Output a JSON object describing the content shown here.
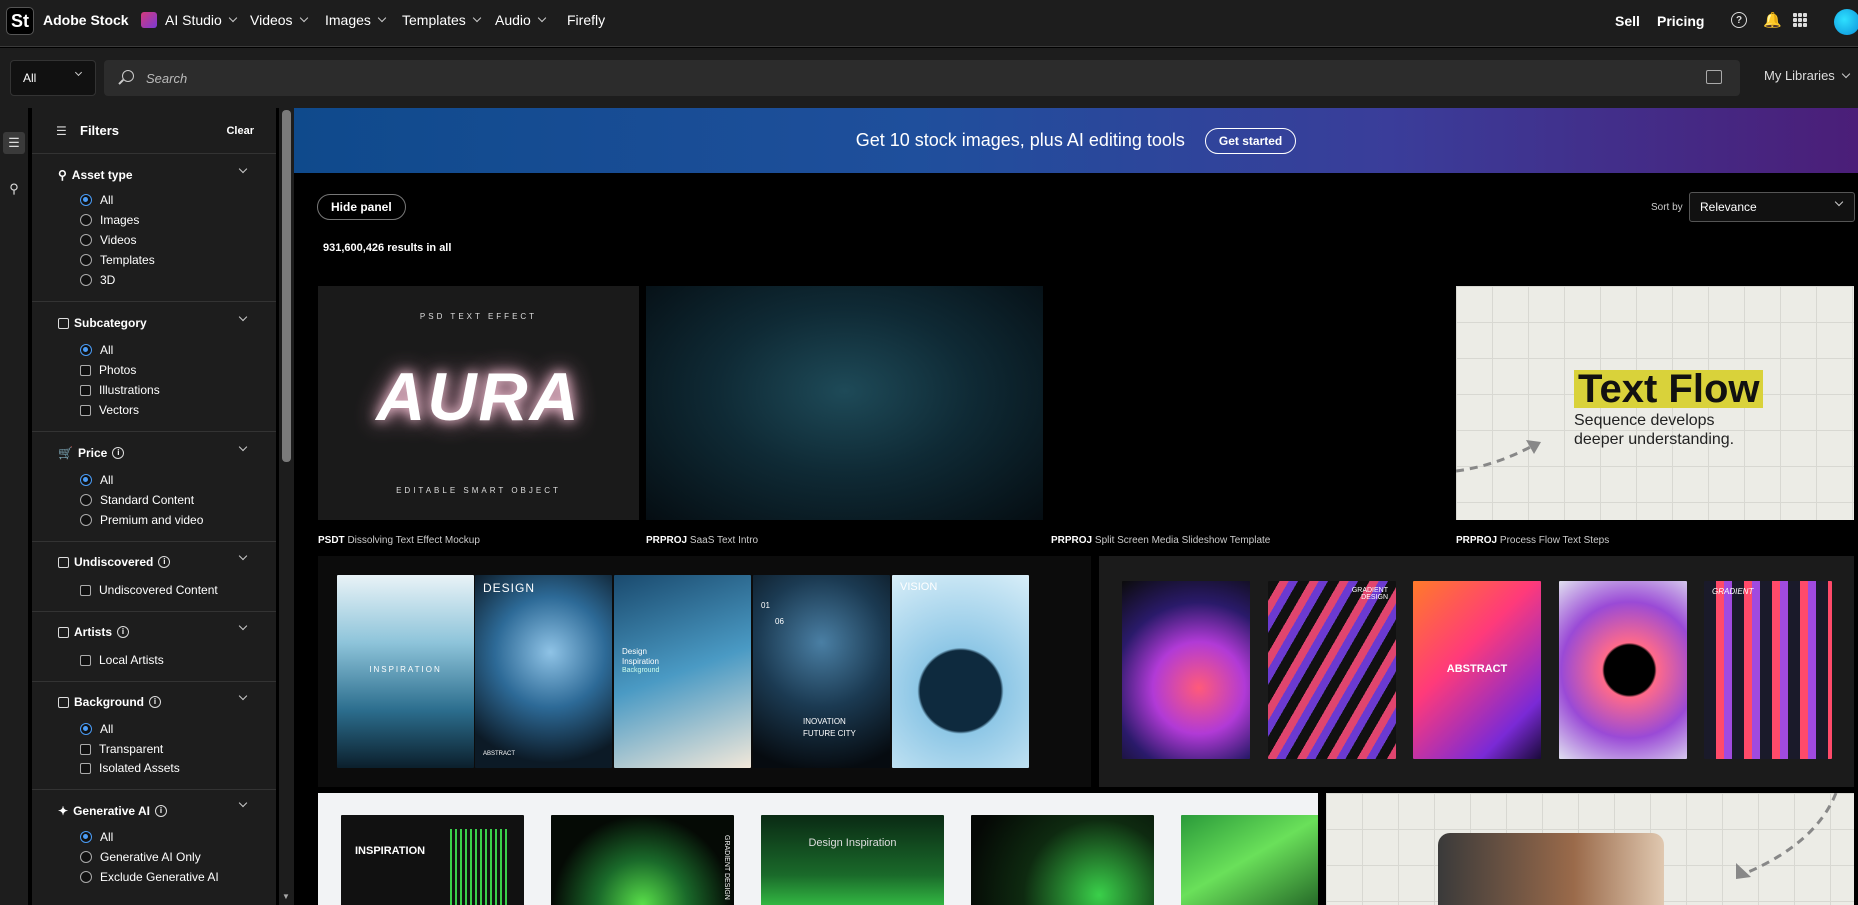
{
  "topnav": {
    "logo": "St",
    "brand": "Adobe Stock",
    "items": [
      "AI Studio",
      "Videos",
      "Images",
      "Templates",
      "Audio",
      "Firefly"
    ],
    "right": [
      "Sell",
      "Pricing"
    ],
    "help": "?"
  },
  "search": {
    "scope": "All",
    "placeholder": "Search",
    "my_libraries": "My Libraries"
  },
  "filters": {
    "title": "Filters",
    "clear": "Clear",
    "asset_type": {
      "title": "Asset type",
      "options": [
        "All",
        "Images",
        "Videos",
        "Templates",
        "3D"
      ],
      "selected": "All"
    },
    "subcategory": {
      "title": "Subcategory",
      "options": [
        "All",
        "Photos",
        "Illustrations",
        "Vectors"
      ],
      "selected": "All"
    },
    "price": {
      "title": "Price",
      "options": [
        "All",
        "Standard Content",
        "Premium and video"
      ],
      "selected": "All"
    },
    "undiscovered": {
      "title": "Undiscovered",
      "options": [
        "Undiscovered Content"
      ]
    },
    "artists": {
      "title": "Artists",
      "options": [
        "Local Artists"
      ]
    },
    "background": {
      "title": "Background",
      "options": [
        "All",
        "Transparent",
        "Isolated Assets"
      ],
      "selected": "All"
    },
    "generative_ai": {
      "title": "Generative AI",
      "options": [
        "All",
        "Generative AI Only",
        "Exclude Generative AI"
      ],
      "selected": "All"
    }
  },
  "promo": {
    "text": "Get 10 stock images, plus AI editing tools",
    "cta": "Get started"
  },
  "main": {
    "hide_panel": "Hide panel",
    "results": "931,600,426 results in all",
    "sort_label": "Sort by",
    "sort_value": "Relevance"
  },
  "tiles": [
    {
      "type": "PSDT",
      "title": "Dissolving Text Effect Mockup",
      "top": "PSD TEXT EFFECT",
      "word": "AURA",
      "bottom": "EDITABLE SMART OBJECT"
    },
    {
      "type": "PRPROJ",
      "title": "SaaS Text Intro"
    },
    {
      "type": "PRPROJ",
      "title": "Split Screen Media Slideshow Template"
    },
    {
      "type": "PRPROJ",
      "title": "Process Flow Text Steps",
      "headline": "Text Flow",
      "sub1": "Sequence develops",
      "sub2": "deeper understanding."
    }
  ],
  "poster_set_1": {
    "p1": "INSPIRATION",
    "p2": "DESIGN",
    "p3a": "Design",
    "p3b": "Inspiration",
    "p3c": "Background",
    "p4a": "01",
    "p4b": "06",
    "p4c": "INOVATION",
    "p4d": "FUTURE CITY",
    "p5": "VISION",
    "p2b": "ABSTRACT"
  },
  "poster_set_2": {
    "p2": "GRADIENT DESIGN",
    "p3": "ABSTRACT",
    "p5": "GRADIENT"
  },
  "poster_set_3": {
    "p1": "INSPIRATION",
    "p2": "GRADIENT DESIGN",
    "p3": "Design Inspiration"
  },
  "colors": {
    "accent": "#4b9cf5",
    "promo_start": "#0f4a8c",
    "promo_end": "#4b1e78",
    "textflow_highlight": "#d9d23a"
  }
}
